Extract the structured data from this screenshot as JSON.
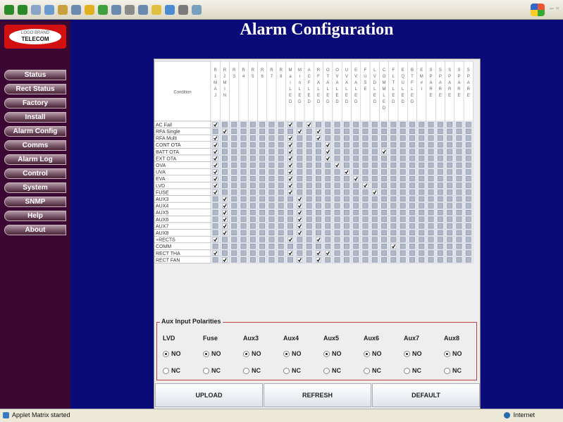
{
  "title": "Alarm Configuration",
  "logo": {
    "line1": "LOGO BRAND",
    "line2": "TELECOM"
  },
  "nav": [
    "Status",
    "Rect Status",
    "Factory",
    "Install",
    "Alarm Config",
    "Comms",
    "Alarm Log",
    "Control",
    "System",
    "SNMP",
    "Help",
    "About"
  ],
  "matrix": {
    "corner_label": "Condition",
    "columns": [
      "R 1 M A J",
      "R 2 M I N",
      "R 3",
      "R 4",
      "R 5",
      "R 6",
      "R 7",
      "R 8",
      "M a i L E D",
      "M i n L E D",
      "A C F L E D",
      "R F A L E D",
      "O T A L E D",
      "O V A L E D",
      "U V A L E D",
      "E V A L E D",
      "F U S E",
      "L V D L E D",
      "C O M M L E D",
      "F L T L E D",
      "E Q U L E D",
      "B T F L E D",
      "E M # I",
      "S P A R E",
      "S P A R E",
      "S P A R E",
      "S P A R E",
      "S P A R E"
    ],
    "rows": [
      {
        "label": "AC Fail",
        "checked": [
          0,
          8,
          10
        ]
      },
      {
        "label": "RFA Single",
        "checked": [
          1,
          9,
          11
        ]
      },
      {
        "label": "RFA Multi",
        "checked": [
          0,
          8,
          11
        ]
      },
      {
        "label": "CONT OTA",
        "checked": [
          0,
          8,
          12
        ]
      },
      {
        "label": "BATT OTA",
        "checked": [
          0,
          8,
          12,
          18
        ]
      },
      {
        "label": "EXT OTA",
        "checked": [
          0,
          8,
          12
        ]
      },
      {
        "label": "OVA",
        "checked": [
          0,
          8,
          13
        ]
      },
      {
        "label": "UVA",
        "checked": [
          0,
          8,
          14
        ]
      },
      {
        "label": "EVA",
        "checked": [
          0,
          8,
          15
        ]
      },
      {
        "label": "LVD",
        "checked": [
          0,
          8,
          16
        ]
      },
      {
        "label": "FUSE",
        "checked": [
          0,
          8,
          17
        ]
      },
      {
        "label": "AUX3",
        "checked": [
          1,
          9
        ]
      },
      {
        "label": "AUX4",
        "checked": [
          1,
          9
        ]
      },
      {
        "label": "AUX5",
        "checked": [
          1,
          9
        ]
      },
      {
        "label": "AUX6",
        "checked": [
          1,
          9
        ]
      },
      {
        "label": "AUX7",
        "checked": [
          1,
          9
        ]
      },
      {
        "label": "AUX8",
        "checked": [
          1,
          9
        ]
      },
      {
        "label": "+RECTS",
        "checked": [
          0,
          8,
          11
        ]
      },
      {
        "label": "COMM",
        "checked": [
          19
        ]
      },
      {
        "label": "RECT THA",
        "checked": [
          0,
          8,
          11,
          12
        ]
      },
      {
        "label": "RECT FAN",
        "checked": [
          1,
          9,
          11
        ]
      }
    ]
  },
  "aux": {
    "title": "Aux Input Polarities",
    "items": [
      "LVD",
      "Fuse",
      "Aux3",
      "Aux4",
      "Aux5",
      "Aux6",
      "Aux7",
      "Aux8"
    ],
    "no_label": "NO",
    "nc_label": "NC",
    "selected": "NO"
  },
  "buttons": {
    "upload": "UPLOAD",
    "refresh": "REFRESH",
    "default": "DEFAULT"
  },
  "status": {
    "left": "Applet Matrix started",
    "right": "Internet"
  },
  "colors": {
    "page_bg": "#0a0a78",
    "sidebar_bg": "#3a0833",
    "logo_bg": "#d31010",
    "cell": "#b0b8c8",
    "aux_border": "#c04040"
  }
}
